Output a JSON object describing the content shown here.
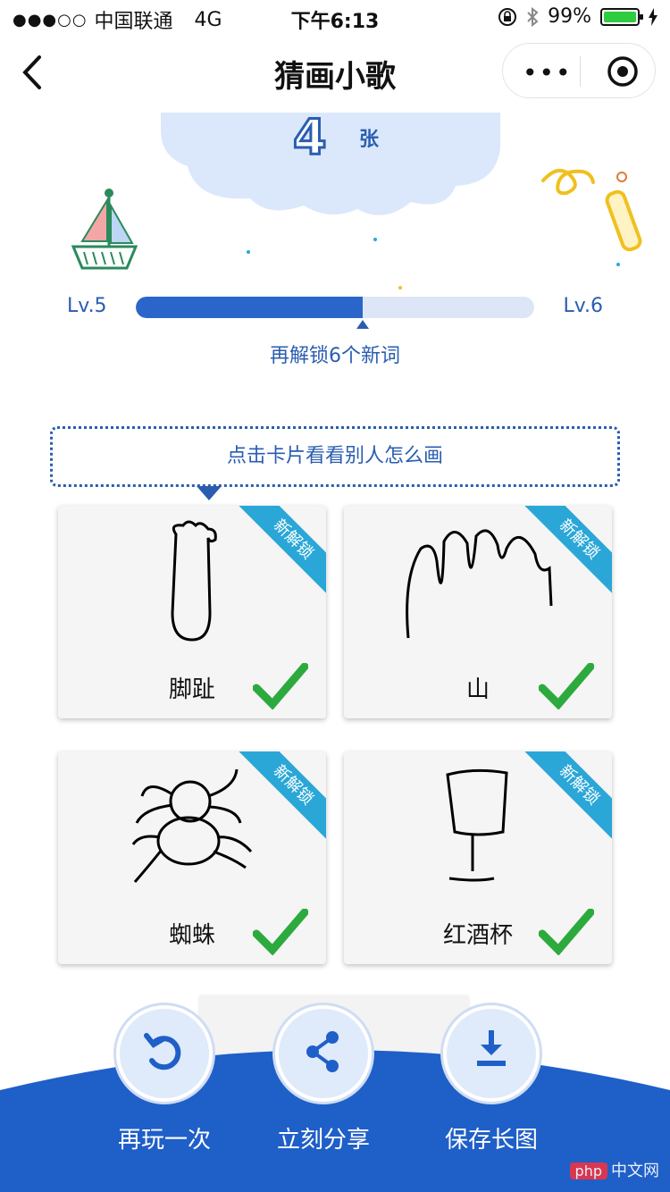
{
  "status_bar": {
    "signal_dots": "●●●○○",
    "carrier": "中国联通",
    "network": "4G",
    "time": "下午6:13",
    "battery_percent_text": "99%",
    "battery_level": 0.99
  },
  "nav": {
    "title": "猜画小歌",
    "back_icon": "chevron-left-icon",
    "more_icon": "more-dots-icon",
    "close_icon": "target-icon"
  },
  "summary": {
    "count": "4",
    "count_unit": "张"
  },
  "progress": {
    "left_level": "Lv.5",
    "right_level": "Lv.6",
    "fraction": 0.57,
    "note": "再解锁6个新词"
  },
  "hint": "点击卡片看看别人怎么画",
  "cards": [
    {
      "badge": "新解锁",
      "word": "脚趾"
    },
    {
      "badge": "新解锁",
      "word": "山"
    },
    {
      "badge": "新解锁",
      "word": "蜘蛛"
    },
    {
      "badge": "新解锁",
      "word": "红酒杯"
    }
  ],
  "actions": [
    {
      "label": "再玩一次",
      "icon": "replay-icon"
    },
    {
      "label": "立刻分享",
      "icon": "share-icon"
    },
    {
      "label": "保存长图",
      "icon": "download-icon"
    }
  ],
  "colors": {
    "primary_blue": "#2a66c9",
    "ribbon": "#2aa7d7",
    "check_green": "#2daa3d"
  },
  "watermark": {
    "badge": "php",
    "text": "中文网"
  }
}
